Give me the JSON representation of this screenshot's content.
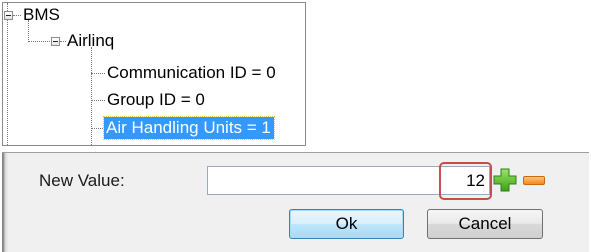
{
  "tree": {
    "root": {
      "label": "BMS"
    },
    "child": {
      "label": "Airlinq"
    },
    "leaves": [
      {
        "label": "Communication ID = 0"
      },
      {
        "label": "Group ID = 0"
      },
      {
        "label": "Air Handling Units = 1",
        "selected": true
      }
    ]
  },
  "dialog": {
    "new_value_label": "New Value:",
    "input_value": "12",
    "ok_label": "Ok",
    "cancel_label": "Cancel"
  },
  "icons": {
    "increment": "plus-icon",
    "decrement": "minus-icon"
  },
  "colors": {
    "selection": "#3399ff",
    "highlight": "#c0504d",
    "plus": "#4cbb17",
    "minus": "#f08a1f"
  }
}
